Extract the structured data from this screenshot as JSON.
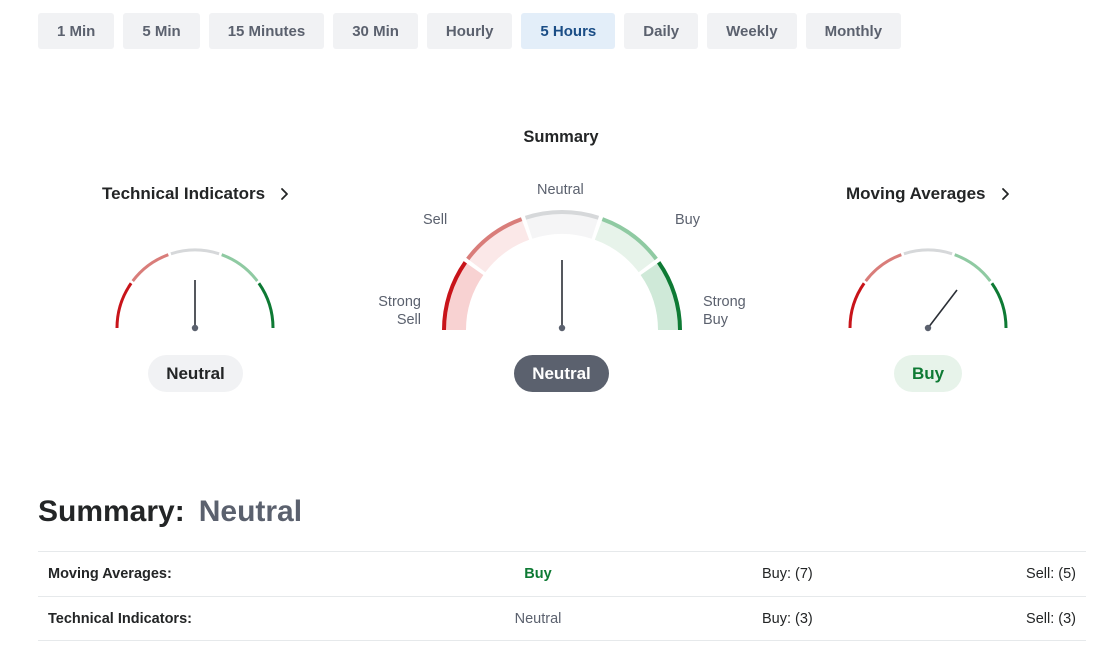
{
  "tabs": [
    {
      "label": "1 Min",
      "active": false
    },
    {
      "label": "5 Min",
      "active": false
    },
    {
      "label": "15 Minutes",
      "active": false
    },
    {
      "label": "30 Min",
      "active": false
    },
    {
      "label": "Hourly",
      "active": false
    },
    {
      "label": "5 Hours",
      "active": true
    },
    {
      "label": "Daily",
      "active": false
    },
    {
      "label": "Weekly",
      "active": false
    },
    {
      "label": "Monthly",
      "active": false
    }
  ],
  "gauges": {
    "summary": {
      "title": "Summary",
      "value": "Neutral",
      "needle_level": 0.0,
      "labels": {
        "strong_sell": "Strong Sell",
        "sell": "Sell",
        "neutral": "Neutral",
        "buy": "Buy",
        "strong_buy": "Strong Buy"
      }
    },
    "technical_indicators": {
      "title": "Technical Indicators",
      "value": "Neutral",
      "needle_level": 0.0
    },
    "moving_averages": {
      "title": "Moving Averages",
      "value": "Buy",
      "needle_level": 0.5
    }
  },
  "summary": {
    "label": "Summary:",
    "value": "Neutral",
    "rows": [
      {
        "label": "Moving Averages:",
        "status": "Buy",
        "buy": "Buy: (7)",
        "sell": "Sell: (5)"
      },
      {
        "label": "Technical Indicators:",
        "status": "Neutral",
        "buy": "Buy: (3)",
        "sell": "Sell: (3)"
      }
    ]
  },
  "colors": {
    "strong_sell": "#c8141a",
    "sell": "#d97d7a",
    "neutral": "#d6d8da",
    "buy": "#8fcaa2",
    "strong_buy": "#0e7a34",
    "active_tab_bg": "#e3eef9",
    "active_tab_text": "#1a4d86"
  }
}
